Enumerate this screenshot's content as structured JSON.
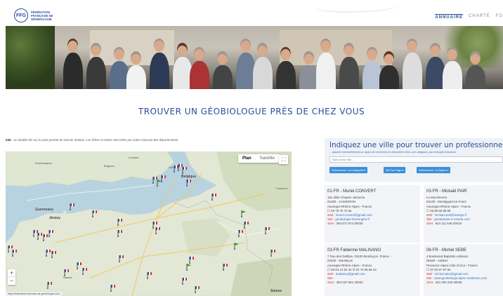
{
  "header": {
    "logo_initials": "FFG",
    "logo_lines": [
      "Fédération",
      "Française de",
      "Géobiologie"
    ],
    "nav": [
      "Annuaire",
      "Charte",
      "Fo"
    ]
  },
  "title": "TROUVER UN GÉOBIOLOGUE PRÈS DE CHEZ VOUS",
  "note": {
    "prefix": "lote",
    "text": " : Un double clic sur la carte permet de zoomer dedans. Les fiches ci-contre sont triées par ordre croissant des départements."
  },
  "map": {
    "tab_plan": "Plan",
    "tab_satellite": "Satellite",
    "fullscreen_icon": "fullscreen-icon",
    "zoom_in": "+",
    "zoom_out": "−",
    "url": "https://federation-francaise-de-geobiologie.com/",
    "places": [
      {
        "name": "Belgique",
        "cls": ""
      },
      {
        "name": "Guernesey",
        "cls": ""
      },
      {
        "name": "Jersey",
        "cls": ""
      },
      {
        "name": "Suisse",
        "cls": ""
      },
      {
        "name": "Southampton",
        "cls": "sm"
      },
      {
        "name": "Brighton",
        "cls": "sm"
      },
      {
        "name": "Londres",
        "cls": "sm"
      },
      {
        "name": "Francfort",
        "cls": "sm"
      },
      {
        "name": "Nantes",
        "cls": "sm"
      },
      {
        "name": "Lille",
        "cls": "sm"
      }
    ]
  },
  "search": {
    "heading": "Indiquez une ville pour trouver un professionnel proche",
    "subheading": "... ajoutez éventuellement un rayon de recherche en kilomètres et/ou une catégorie, par exemple formateur.",
    "city_placeholder": "Nom d'une ville ...",
    "category_label": "Sélectionner La Catégorie",
    "per_page_label": "Nb Par Page",
    "radius_label": "Sélectionner Le Rayon"
  },
  "cards": [
    {
      "name": "01-FR - Muriel CONVERT",
      "lines": [
        "181 allée Chapon Jasseron",
        "01250 - JASSERON",
        "Auvergne-Rhône-Alpes - France"
      ],
      "phone": "06 78 70 73 82",
      "mail_label": "Mail :",
      "mail": "muriel.convert@gmail.com",
      "site_label": "Site :",
      "site": "geobiologie-bourengne.fr",
      "siret_label": "Siret :",
      "siret": "383 671 872 00026"
    },
    {
      "name": "03-FR - Mickaël PAIR",
      "lines": [
        "Le Moncherein",
        "03130 - Montaiguët-en-Forez",
        "Auvergne-Rhône-Alpes - France"
      ],
      "phone": "06.80.50.85.59",
      "mail_label": "Mail :",
      "mail": "mickael.pair@orange.fr",
      "site_label": "Site :",
      "site": "geobiolavie-a-mirette.com",
      "siret_label": "Siret :",
      "siret": "824 111 546 00019"
    },
    {
      "name": "03-FR Fabienne MALISANO",
      "lines": [
        "7 Rue des Dahlias, 03100 Montluçon, France -",
        "03100 - Montluçon",
        "Auvergne-Rhône-Alpes - France"
      ],
      "phone": "06 84 13 92 34",
      "phone2": "04 70 05 66 42",
      "mail_label": "Mail :",
      "mail": "malisano@gmail.com",
      "site_label": "Site :",
      "site": "",
      "siret_label": "Siret :",
      "siret": "484 037 961 00020"
    },
    {
      "name": "06-FR - Michel SEBE",
      "lines": [
        "4 Boulevard Baptistin Ardisson",
        "06160 - Antibes",
        "Provence-Alpes-Côte d'Azur - France"
      ],
      "phone": "07 60 57 97 94",
      "mail_label": "Mail :",
      "mail": "michel.sebe@gmail.com",
      "site_label": "Site :",
      "site": "www.geobiologie-alpes-maritimes.com",
      "siret_label": "Siret :",
      "siret": "344 200 225 00045"
    }
  ],
  "colors": {
    "brand": "#2a4d9b",
    "accent": "#3b8fd9",
    "logo_red": "#d1332b"
  }
}
